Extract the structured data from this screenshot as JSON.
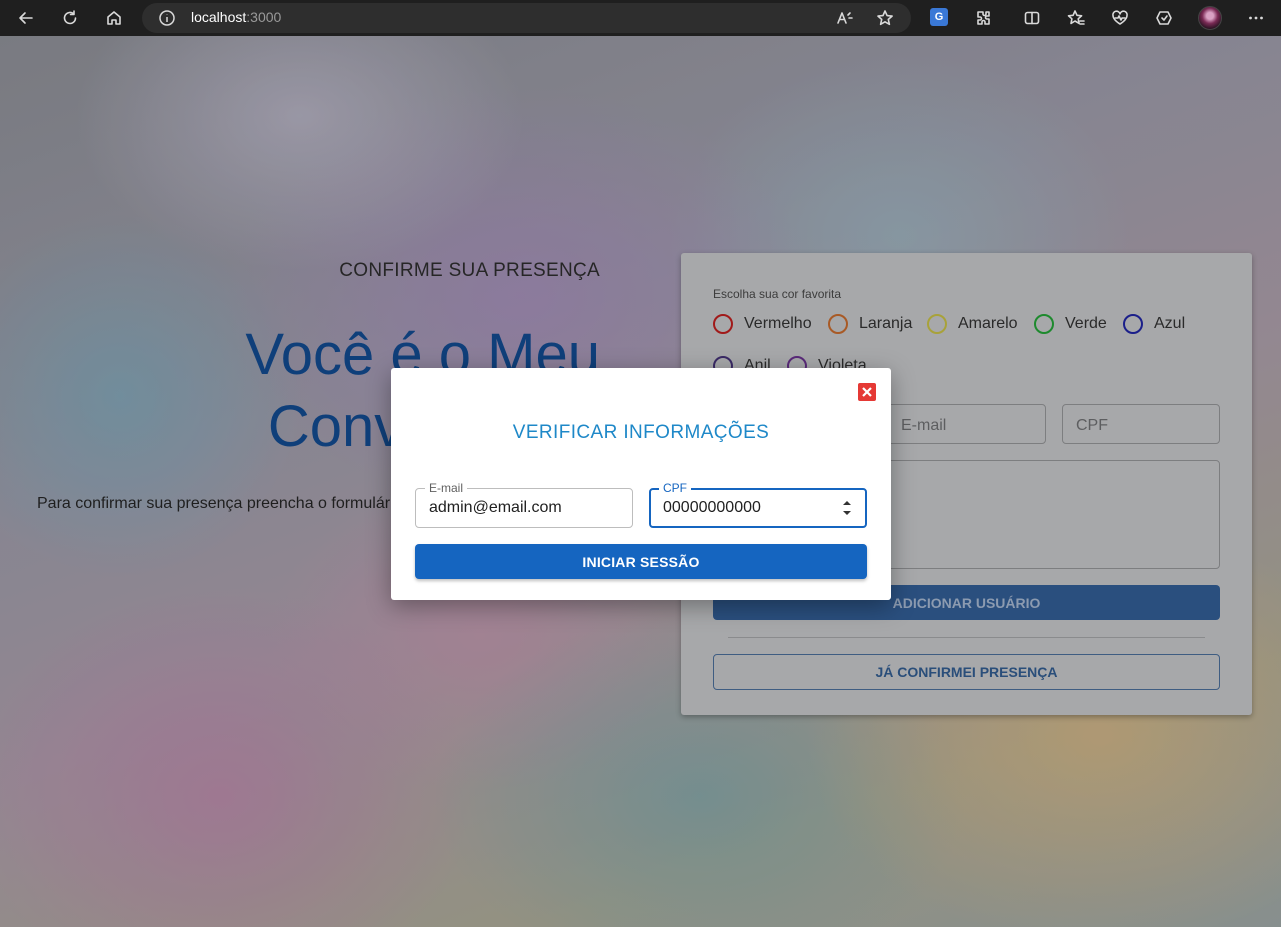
{
  "browser": {
    "url_host": "localhost",
    "url_port": ":3000",
    "icons": [
      "back-icon",
      "reload-icon",
      "home-icon",
      "info-icon",
      "read-aloud-icon",
      "favorite-star-icon",
      "translate-icon",
      "extensions-icon",
      "split-screen-icon",
      "favorites-icon",
      "health-icon",
      "copilot-icon",
      "profile-avatar",
      "more-icon"
    ],
    "translate_glyph": "G"
  },
  "hero": {
    "kicker": "CONFIRME SUA PRESENÇA",
    "title_line1": "Você é o Meu",
    "title_line2": "Convidado E",
    "description": "Para confirmar sua presença preencha o formulári"
  },
  "form": {
    "color_label": "Escolha sua cor favorita",
    "colors": [
      {
        "label": "Vermelho",
        "color": "#a11a1a"
      },
      {
        "label": "Laranja",
        "color": "#a85a26"
      },
      {
        "label": "Amarelo",
        "color": "#a8a23a"
      },
      {
        "label": "Verde",
        "color": "#1e8a2e"
      },
      {
        "label": "Azul",
        "color": "#1b1f8a"
      },
      {
        "label": "Anil",
        "color": "#3a2a66"
      },
      {
        "label": "Violeta",
        "color": "#5a2a7a"
      }
    ],
    "email_placeholder": "E-mail",
    "cpf_placeholder": "CPF",
    "add_button": "ADICIONAR USUÁRIO",
    "confirmed_button": "JÁ CONFIRMEI PRESENÇA"
  },
  "modal": {
    "title": "VERIFICAR INFORMAÇÕES",
    "email_label": "E-mail",
    "email_value": "admin@email.com",
    "cpf_label": "CPF",
    "cpf_value": "00000000000",
    "submit_button": "INICIAR SESSÃO",
    "close_color": "#e53935",
    "accent": "#1565c0"
  }
}
